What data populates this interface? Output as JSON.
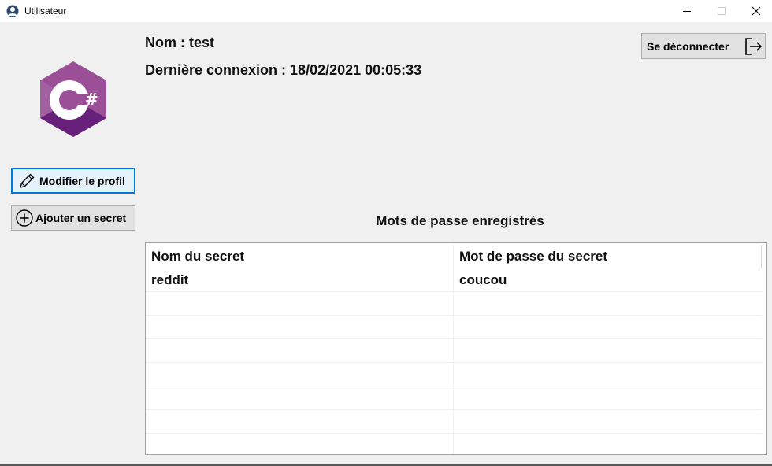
{
  "window": {
    "title": "Utilisateur",
    "controls": [
      "minimize-icon",
      "maximize-icon",
      "close-icon"
    ]
  },
  "user": {
    "name_line": "Nom : test",
    "last_login_line": "Dernière connexion : 18/02/2021 00:05:33"
  },
  "logo": {
    "text": "C#",
    "colors": [
      "#9b4f96",
      "#68217a",
      "#ffffff"
    ]
  },
  "buttons": {
    "modify_profile": "Modifier le profil",
    "add_secret": "Ajouter un secret",
    "logout": "Se déconnecter"
  },
  "icons": {
    "modify_profile": "pencil-icon",
    "add_secret": "plus-circle-icon",
    "logout": "logout-icon"
  },
  "secrets": {
    "title": "Mots de passe enregistrés",
    "columns": [
      "Nom du secret",
      "Mot de passe du secret"
    ],
    "rows": [
      [
        "reddit",
        "coucou"
      ],
      [
        "",
        ""
      ],
      [
        "",
        ""
      ],
      [
        "",
        ""
      ],
      [
        "",
        ""
      ],
      [
        "",
        ""
      ],
      [
        "",
        ""
      ],
      [
        "",
        ""
      ]
    ]
  },
  "colors": {
    "focus_border": "#0078d7",
    "background": "#f0f0f0",
    "button": "#e1e1e1"
  }
}
